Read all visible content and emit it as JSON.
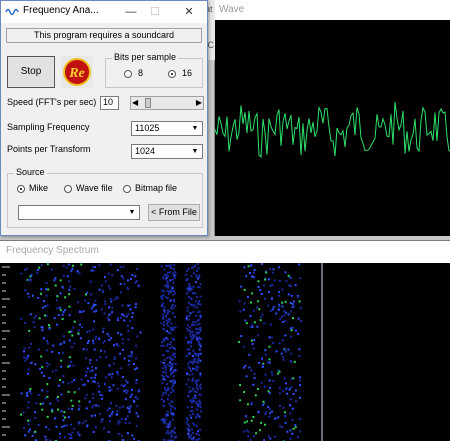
{
  "analyzer": {
    "title": "Frequency Ana...",
    "notice": "This program requires a soundcard",
    "stop_label": "Stop",
    "logo_text": "Re",
    "bits": {
      "title": "Bits per sample",
      "options": [
        {
          "label": "8",
          "selected": false
        },
        {
          "label": "16",
          "selected": true
        }
      ]
    },
    "speed": {
      "label": "Speed (FFT's per sec)",
      "value": "10"
    },
    "sampling": {
      "label": "Sampling Frequency",
      "value": "11025"
    },
    "points": {
      "label": "Points per Transform",
      "value": "1024"
    },
    "source": {
      "title": "Source",
      "options": [
        {
          "label": "Mike",
          "selected": true
        },
        {
          "label": "Wave file",
          "selected": false
        },
        {
          "label": "Bitmap file",
          "selected": false
        }
      ],
      "file_value": "",
      "from_file_label": "< From File"
    },
    "controls": {
      "minimize": "—",
      "maximize": "☐",
      "close": "✕"
    }
  },
  "wave": {
    "title": "Wave",
    "trace_color": "#2ee06a"
  },
  "spectrum": {
    "title": "Frequency Spectrum"
  },
  "behind_text": "at\n\n[C"
}
